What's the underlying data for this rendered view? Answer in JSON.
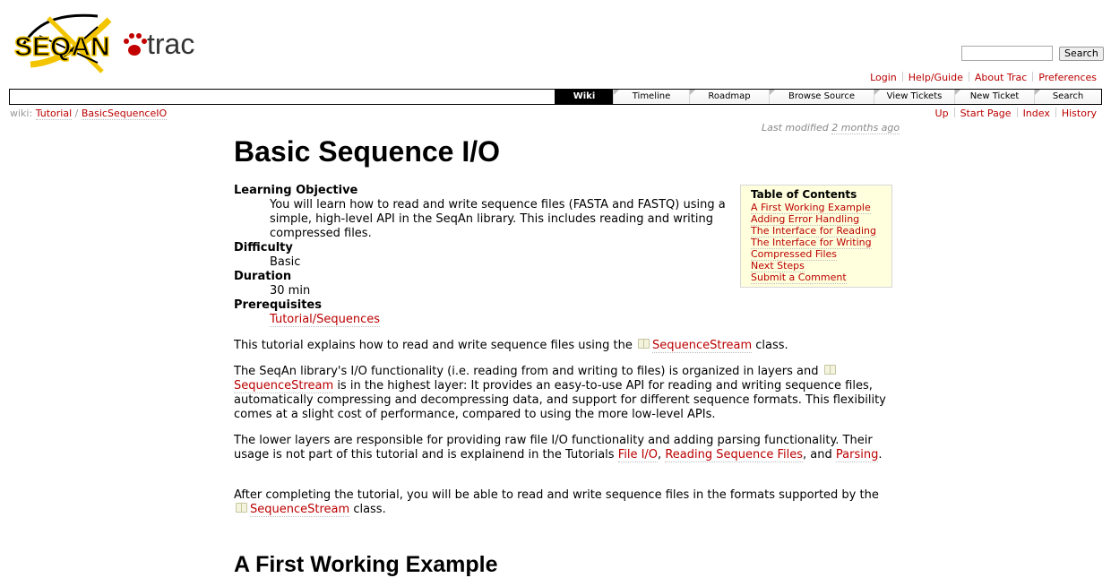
{
  "logo": {
    "seqan": "SEQAN",
    "trac": "trac"
  },
  "search": {
    "placeholder": "",
    "button": "Search"
  },
  "metanav": [
    "Login",
    "Help/Guide",
    "About Trac",
    "Preferences"
  ],
  "mainnav": [
    {
      "label": "Wiki",
      "active": true
    },
    {
      "label": "Timeline"
    },
    {
      "label": "Roadmap"
    },
    {
      "label": "Browse Source"
    },
    {
      "label": "View Tickets"
    },
    {
      "label": "New Ticket"
    },
    {
      "label": "Search"
    }
  ],
  "breadcrumb": {
    "prefix": "wiki:",
    "items": [
      "Tutorial",
      "BasicSequenceIO"
    ],
    "separator": "/"
  },
  "ctxtnav": [
    "Up",
    "Start Page",
    "Index",
    "History"
  ],
  "lastmod": {
    "text": "Last modified",
    "link": "2 months ago"
  },
  "page": {
    "title": "Basic Sequence I/O",
    "info": {
      "objective_label": "Learning Objective",
      "objective": "You will learn how to read and write sequence files (FASTA and FASTQ) using a simple, high-level API in the SeqAn library. This includes reading and writing compressed files.",
      "difficulty_label": "Difficulty",
      "difficulty": "Basic",
      "duration_label": "Duration",
      "duration": "30 min",
      "prereq_label": "Prerequisites",
      "prereq": "Tutorial/Sequences"
    },
    "toc": {
      "title": "Table of Contents",
      "items": [
        "A First Working Example",
        "Adding Error Handling",
        "The Interface for Reading",
        "The Interface for Writing",
        "Compressed Files",
        "Next Steps",
        "Submit a Comment"
      ]
    },
    "p1": {
      "a": "This tutorial explains how to read and write sequence files using the",
      "link": "SequenceStream",
      "b": "class."
    },
    "p2": {
      "a": "The SeqAn library's I/O functionality (i.e. reading from and writing to files) is organized in layers and",
      "link": "SequenceStream",
      "b": "is in the highest layer: It provides an easy-to-use API for reading and writing sequence files, automatically compressing and decompressing data, and support for different sequence formats. This flexibility comes at a slight cost of performance, compared to using the more low-level APIs."
    },
    "p3": {
      "a": "The lower layers are responsible for providing raw file I/O functionality and adding parsing functionality. Their usage is not part of this tutorial and is explainend in the Tutorials",
      "link1": "File I/O",
      "sep1": ",",
      "link2": "Reading Sequence Files",
      "sep2": ", and",
      "link3": "Parsing",
      "end": "."
    },
    "p4": {
      "a": "After completing the tutorial, you will be able to read and write sequence files in the formats supported by the",
      "link": "SequenceStream",
      "b": "class."
    },
    "h2": "A First Working Example"
  }
}
